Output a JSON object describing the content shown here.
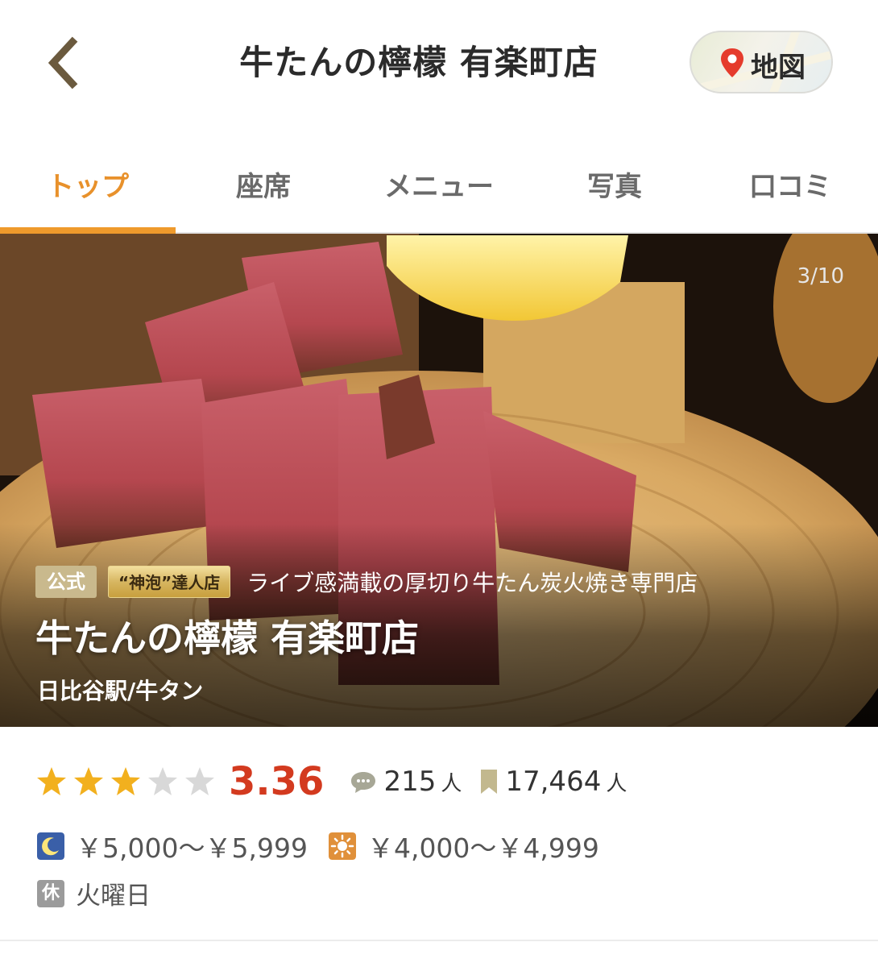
{
  "header": {
    "title": "牛たんの檸檬 有楽町店",
    "map_label": "地図"
  },
  "tabs": [
    {
      "label": "トップ",
      "active": true
    },
    {
      "label": "座席",
      "active": false
    },
    {
      "label": "メニュー",
      "active": false
    },
    {
      "label": "写真",
      "active": false
    },
    {
      "label": "口コミ",
      "active": false
    }
  ],
  "hero": {
    "counter": "3/10",
    "badge_official": "公式",
    "badge_kamiawa": "“神泡”達人店",
    "catchcopy": "ライブ感満載の厚切り牛たん炭火焼き専門店",
    "name": "牛たんの檸檬 有楽町店",
    "area_genre": "日比谷駅/牛タン"
  },
  "rating": {
    "stars_filled": 3,
    "stars_total": 5,
    "score": "3.36",
    "reviews": "215",
    "reviews_unit": "人",
    "bookmarks": "17,464",
    "bookmarks_unit": "人"
  },
  "price": {
    "dinner": "￥5,000～￥5,999",
    "lunch": "￥4,000～￥4,999"
  },
  "holiday": {
    "icon_label": "休",
    "value": "火曜日"
  },
  "colors": {
    "accent": "#ef9a2c",
    "score": "#d33a1f",
    "star_on": "#f2b01e",
    "star_off": "#d8d8d8",
    "dinner_icon": "#3a5fa8",
    "lunch_icon": "#e0903a"
  },
  "icons": {
    "back": "chevron-left-icon",
    "map": "map-pin-icon",
    "reviews": "speech-bubble-icon",
    "bookmark": "bookmark-icon",
    "dinner": "moon-icon",
    "lunch": "sun-icon"
  }
}
